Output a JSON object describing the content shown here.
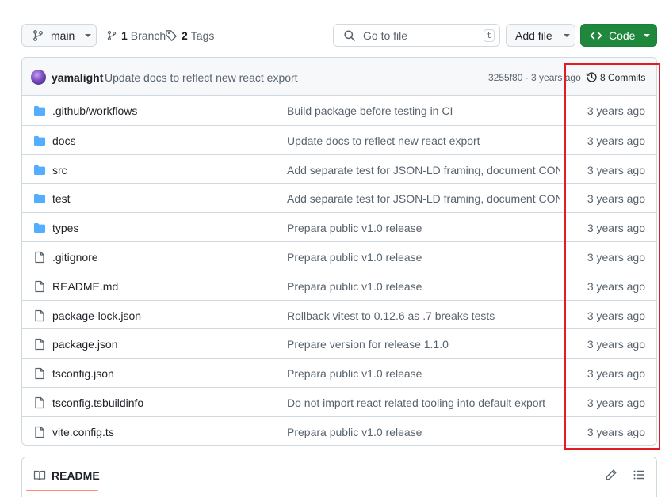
{
  "toolbar": {
    "branch": "main",
    "branches_count": "1",
    "branches_label": "Branch",
    "tags_count": "2",
    "tags_label": "Tags",
    "goto_placeholder": "Go to file",
    "goto_shortcut": "t",
    "add_file_label": "Add file",
    "code_label": "Code"
  },
  "latest_commit": {
    "author": "yamalight",
    "message": "Update docs to reflect new react export",
    "sha_time": "3255f80 · 3 years ago",
    "commits_label": "8 Commits"
  },
  "files": [
    {
      "name": ".github/workflows",
      "type": "folder",
      "message": "Build package before testing in CI",
      "age": "3 years ago"
    },
    {
      "name": "docs",
      "type": "folder",
      "message": "Update docs to reflect new react export",
      "age": "3 years ago"
    },
    {
      "name": "src",
      "type": "folder",
      "message": "Add separate test for JSON-LD framing, document CONS…",
      "age": "3 years ago"
    },
    {
      "name": "test",
      "type": "folder",
      "message": "Add separate test for JSON-LD framing, document CONS…",
      "age": "3 years ago"
    },
    {
      "name": "types",
      "type": "folder",
      "message": "Prepara public v1.0 release",
      "age": "3 years ago"
    },
    {
      "name": ".gitignore",
      "type": "file",
      "message": "Prepara public v1.0 release",
      "age": "3 years ago"
    },
    {
      "name": "README.md",
      "type": "file",
      "message": "Prepara public v1.0 release",
      "age": "3 years ago"
    },
    {
      "name": "package-lock.json",
      "type": "file",
      "message": "Rollback vitest to 0.12.6 as .7 breaks tests",
      "age": "3 years ago"
    },
    {
      "name": "package.json",
      "type": "file",
      "message": "Prepare version for release 1.1.0",
      "age": "3 years ago"
    },
    {
      "name": "tsconfig.json",
      "type": "file",
      "message": "Prepara public v1.0 release",
      "age": "3 years ago"
    },
    {
      "name": "tsconfig.tsbuildinfo",
      "type": "file",
      "message": "Do not import react related tooling into default export",
      "age": "3 years ago"
    },
    {
      "name": "vite.config.ts",
      "type": "file",
      "message": "Prepara public v1.0 release",
      "age": "3 years ago"
    }
  ],
  "readme": {
    "tab_label": "README"
  },
  "colors": {
    "folder_icon": "#54aeff",
    "code_button": "#1f883d",
    "highlight_box": "#e01c24",
    "readme_underline": "#fd8c73"
  }
}
